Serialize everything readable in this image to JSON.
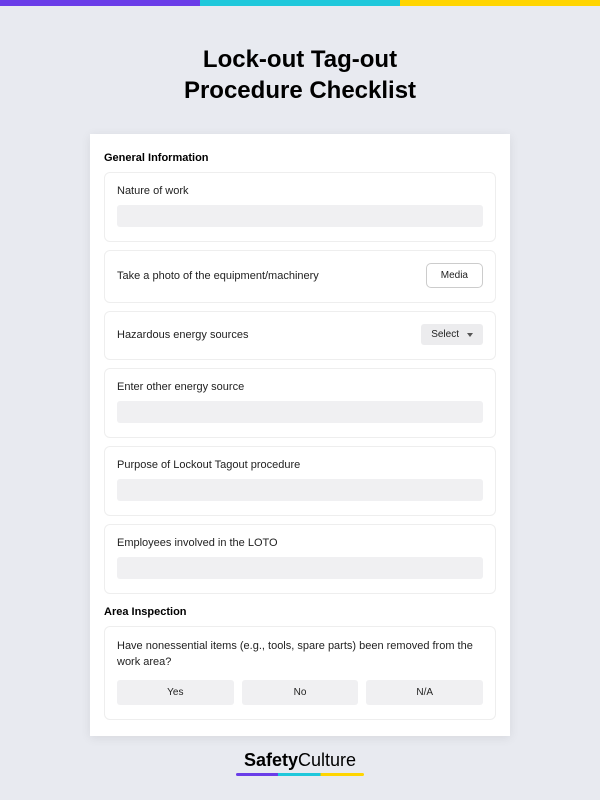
{
  "title_line1": "Lock-out Tag-out",
  "title_line2": "Procedure Checklist",
  "sections": {
    "general": {
      "header": "General Information",
      "nature_label": "Nature of work",
      "photo_label": "Take a photo of the equipment/machinery",
      "media_btn": "Media",
      "hazardous_label": "Hazardous energy sources",
      "select_btn": "Select",
      "other_source_label": "Enter other energy source",
      "purpose_label": "Purpose of Lockout Tagout procedure",
      "employees_label": "Employees involved in the LOTO"
    },
    "inspection": {
      "header": "Area Inspection",
      "question": "Have nonessential items (e.g., tools, spare parts) been removed from the work area?",
      "opt_yes": "Yes",
      "opt_no": "No",
      "opt_na": "N/A"
    }
  },
  "footer": {
    "brand_strong": "Safety",
    "brand_light": "Culture"
  }
}
